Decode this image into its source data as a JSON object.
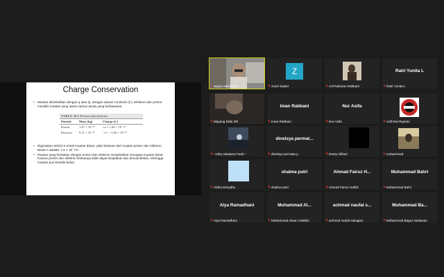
{
  "slide": {
    "title": "Charge Conservation",
    "bullet1": "Muatan disimbolkan dengan q atau Q, dengan satuan Coulomb (C). Elektron dan proton memiliki muatan yang sama namun tanda yang berlawanan.",
    "table": {
      "caption_num": "TABLE 20.1",
      "caption_text": "Protons and electrons",
      "headers": [
        "Particle",
        "Mass (kg)",
        "Charge (C)"
      ],
      "rows": [
        [
          "Proton",
          "1.67 × 10⁻²⁷",
          "+e = 1.60 × 10⁻¹⁹"
        ],
        [
          "Electron",
          "9.11 × 10⁻³¹",
          "−e = −1.60 × 10⁻¹⁹"
        ]
      ]
    },
    "bullet2": "Digunakan simbol e untuk muatan dasar, yaitu besaran dari muatan proton dan elektron. Besar e adalah: 1.6 × 10⁻¹⁹C.",
    "bullet3": "Muatan yang berkaitan dengan proton dan elektron menjelaskan mengapa muatan kekal. Karena proton dan elektron keduanya tidak dapat diciptakan dan dimusnahkan, sehingga muatan pun bersifat kekal."
  },
  "participants": [
    {
      "label": "wijaya adidarma",
      "big": "",
      "kind": "video"
    },
    {
      "label": "zoom baa04",
      "big": "Z",
      "kind": "letter"
    },
    {
      "label": "Arif Rahman Rabbani",
      "big": "",
      "kind": "statue"
    },
    {
      "label": "Ratri Yunita L",
      "big": "Ratri Yunita L",
      "kind": "name"
    },
    {
      "label": "Mayang Dafa DR",
      "big": "",
      "kind": "photo"
    },
    {
      "label": "Iman Rabbani",
      "big": "Iman Rabbani",
      "kind": "name"
    },
    {
      "label": "Nur Asifa",
      "big": "Nur Asifa",
      "kind": "name"
    },
    {
      "label": "Adif Dwi Riyanto",
      "big": "",
      "kind": "logo"
    },
    {
      "label": "~Vikry Maulana Fadri~",
      "big": "",
      "kind": "sunset"
    },
    {
      "label": "dinelsya permata p",
      "big": "dinelsya  permat...",
      "kind": "name"
    },
    {
      "label": "Danty Alifiani",
      "big": "",
      "kind": "black"
    },
    {
      "label": "muhammad",
      "big": "",
      "kind": "street"
    },
    {
      "label": "Aldira Desqitha",
      "big": "",
      "kind": "sky"
    },
    {
      "label": "shalma putri",
      "big": "shalma putri",
      "kind": "name"
    },
    {
      "label": "Ahmad Fairuz Hafidz",
      "big": "Ahmad Fairuz H...",
      "kind": "name"
    },
    {
      "label": "Muhammad Bahri",
      "big": "Muhammad Bahri",
      "kind": "name"
    },
    {
      "label": "Alya Ramadhani",
      "big": "Alya Ramadhani",
      "kind": "name"
    },
    {
      "label": "Muhammad Alwan Habibie",
      "big": "Muhammad  Al...",
      "kind": "name"
    },
    {
      "label": "achmad naufal sailagian",
      "big": "achmad naufal s...",
      "kind": "name"
    },
    {
      "label": "Muhammad Bagus Setiawan",
      "big": "Muhammad  Ba...",
      "kind": "name"
    }
  ]
}
